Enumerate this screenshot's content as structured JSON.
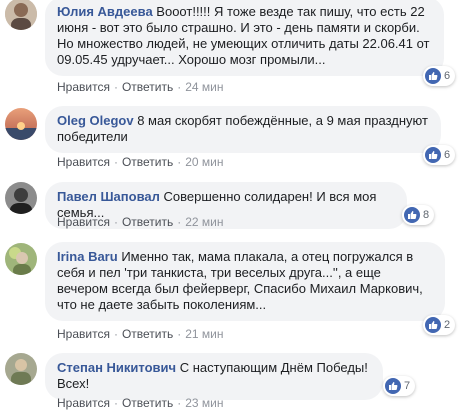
{
  "like_color": "#4267b2",
  "comments": [
    {
      "author": "Юлия Авдеева",
      "text": "Вооот!!!!! Я тоже везде так пишу, что есть 22 июня - вот это было страшно. И это - день памяти и скорби. Но множество людей, не умеющих отличить даты 22.06.41 от 09.05.45 удручает... Хорошо мозг промыли...",
      "action_like": "Нравится",
      "action_reply": "Ответить",
      "time": "24 мин",
      "likes": "6"
    },
    {
      "author": "Oleg Olegov",
      "text": "8 мая скорбят побеждённые, а 9 мая празднуют победители",
      "action_like": "Нравится",
      "action_reply": "Ответить",
      "time": "20 мин",
      "likes": "6"
    },
    {
      "author": "Павел Шаповал",
      "text": "Совершенно солидарен! И вся моя семья...",
      "action_like": "Нравится",
      "action_reply": "Ответить",
      "time": "22 мин",
      "likes": "8"
    },
    {
      "author": "Irina Baru",
      "text": "Именно так, мама плакала, а отец погружался в себя и пел 'три танкиста, три веселых друга...'', а еще вечером всегда был фейерверг, Спасибо Михаил Маркович, что не даете забыть поколениям...",
      "action_like": "Нравится",
      "action_reply": "Ответить",
      "time": "21 мин",
      "likes": "2"
    },
    {
      "author": "Степан Никитович",
      "text": "С наступающим Днём Победы! Всех!",
      "action_like": "Нравится",
      "action_reply": "Ответить",
      "time": "23 мин",
      "likes": "7"
    }
  ]
}
